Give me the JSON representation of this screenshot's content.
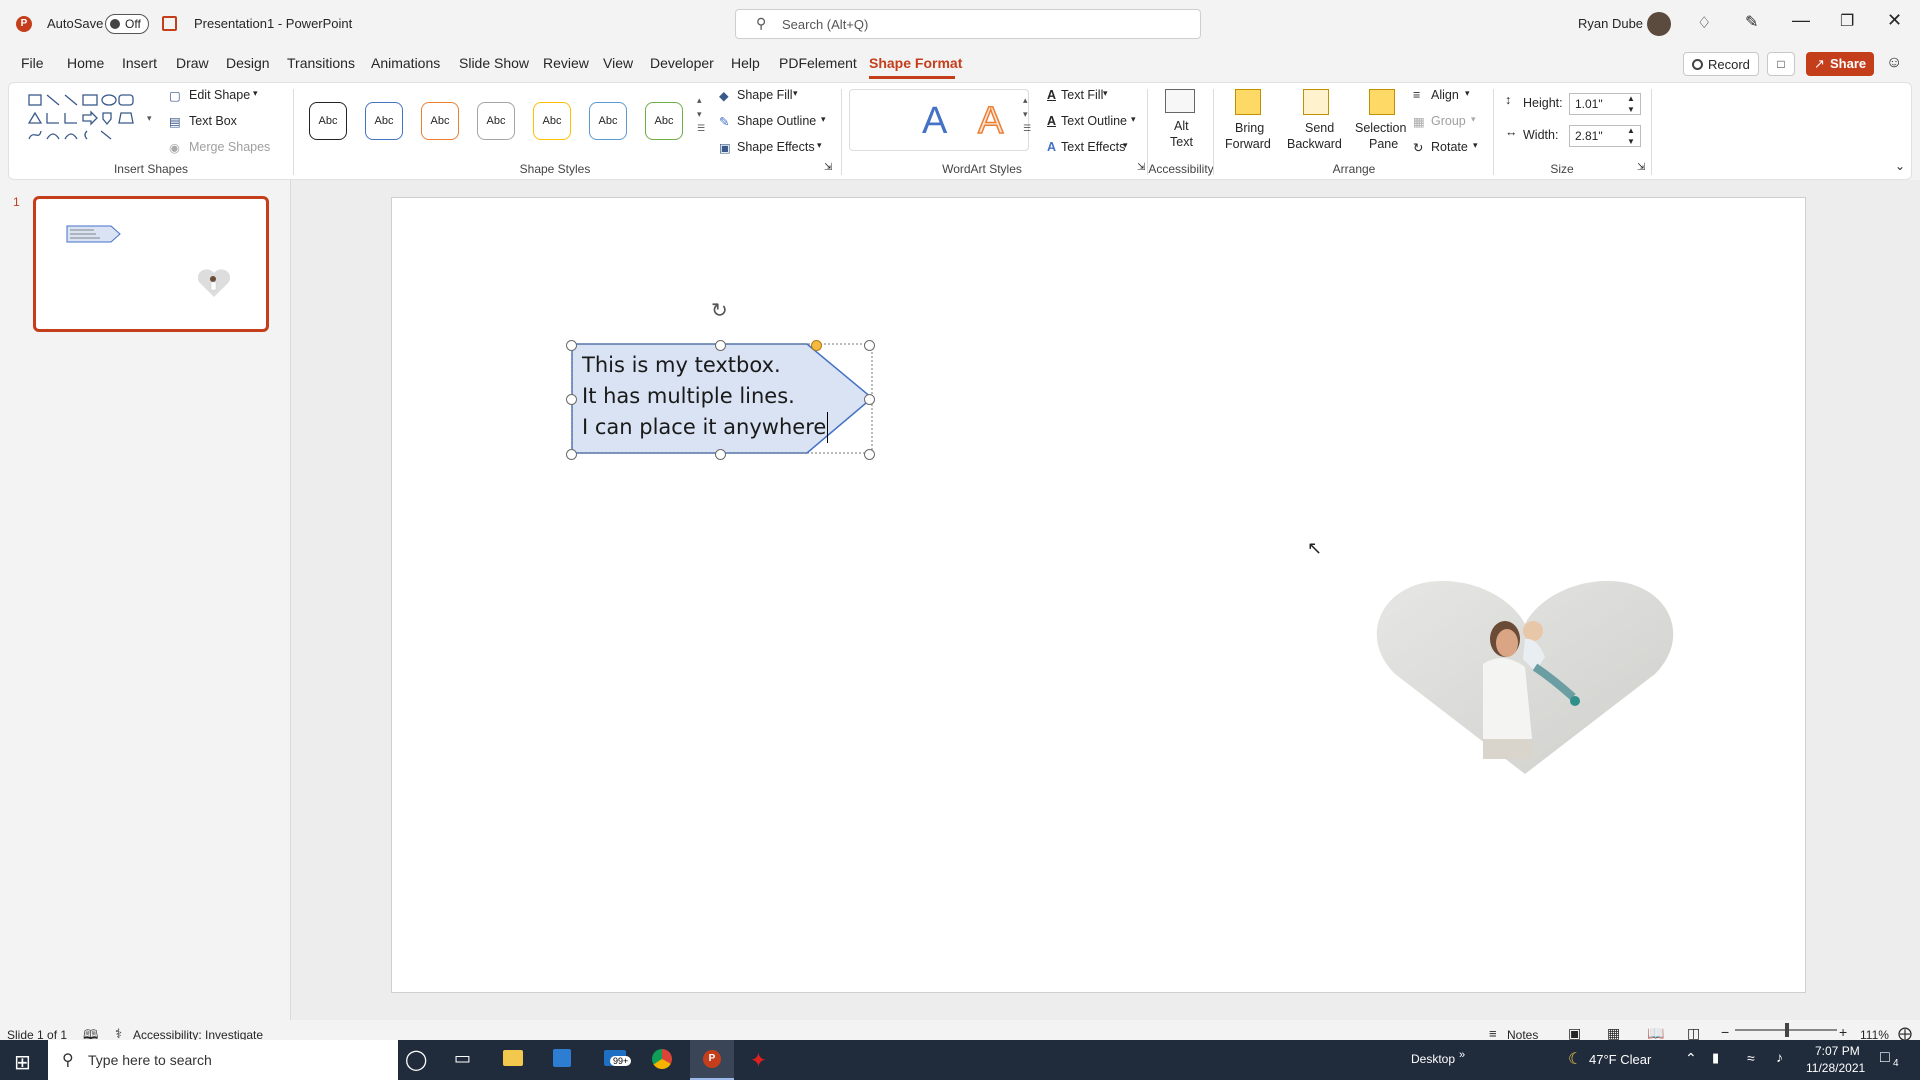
{
  "titlebar": {
    "autosave_label": "AutoSave",
    "autosave_state": "Off",
    "doc_title": "Presentation1  -  PowerPoint",
    "search_placeholder": "Search (Alt+Q)",
    "user_name": "Ryan Dube"
  },
  "menu": {
    "items": [
      "File",
      "Home",
      "Insert",
      "Draw",
      "Design",
      "Transitions",
      "Animations",
      "Slide Show",
      "Review",
      "View",
      "Developer",
      "Help",
      "PDFelement",
      "Shape Format"
    ],
    "active": "Shape Format",
    "record_label": "Record",
    "share_label": "Share"
  },
  "ribbon": {
    "insert_shapes": {
      "edit_shape": "Edit Shape",
      "text_box": "Text Box",
      "merge_shapes": "Merge Shapes",
      "label": "Insert Shapes"
    },
    "shape_styles": {
      "swatch_text": "Abc",
      "shape_fill": "Shape Fill",
      "shape_outline": "Shape Outline",
      "shape_effects": "Shape Effects",
      "label": "Shape Styles"
    },
    "wordart": {
      "glyph": "A",
      "text_fill": "Text Fill",
      "text_outline": "Text Outline",
      "text_effects": "Text Effects",
      "label": "WordArt Styles"
    },
    "accessibility": {
      "alt_text_line1": "Alt",
      "alt_text_line2": "Text",
      "label": "Accessibility"
    },
    "arrange": {
      "bring_forward_1": "Bring",
      "bring_forward_2": "Forward",
      "send_backward_1": "Send",
      "send_backward_2": "Backward",
      "selection_pane_1": "Selection",
      "selection_pane_2": "Pane",
      "align": "Align",
      "group": "Group",
      "rotate": "Rotate",
      "label": "Arrange"
    },
    "size": {
      "height_label": "Height:",
      "height_value": "1.01\"",
      "width_label": "Width:",
      "width_value": "2.81\"",
      "label": "Size"
    }
  },
  "thumbnail": {
    "number": "1"
  },
  "slide": {
    "textbox_lines": [
      "This is my textbox.",
      "It has multiple lines.",
      "I can place it anywhere"
    ]
  },
  "status": {
    "slide_info": "Slide 1 of 1",
    "accessibility": "Accessibility: Investigate",
    "notes": "Notes",
    "zoom": "111%"
  },
  "taskbar": {
    "search_placeholder": "Type here to search",
    "mail_badge": "99+",
    "desktop_label": "Desktop",
    "weather": "47°F  Clear",
    "time": "7:07 PM",
    "date": "11/28/2021",
    "notification_count": "4"
  },
  "colors": {
    "accent": "#c43e1c",
    "share_button": "#c43e1c",
    "textbox_fill": "#dae3f3",
    "textbox_outline": "#4472c4",
    "taskbar": "#202b3c"
  }
}
